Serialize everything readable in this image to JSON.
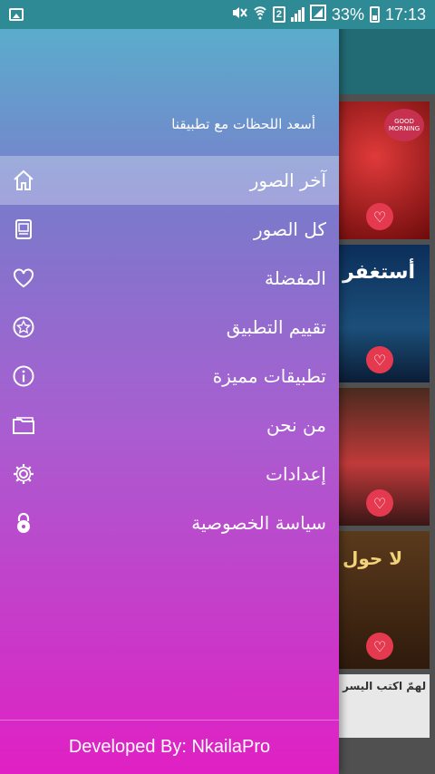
{
  "status_bar": {
    "battery_percent": "33%",
    "time": "17:13",
    "sim_slot": "2"
  },
  "drawer": {
    "header_text": "أسعد اللحظات مع تطبيقنا",
    "items": [
      {
        "label": "آخر الصور",
        "icon": "home-icon",
        "active": true
      },
      {
        "label": "كل الصور",
        "icon": "photo-album-icon",
        "active": false
      },
      {
        "label": "المفضلة",
        "icon": "heart-icon",
        "active": false
      },
      {
        "label": "تقييم التطبيق",
        "icon": "star-rate-icon",
        "active": false
      },
      {
        "label": "تطبيقات مميزة",
        "icon": "info-icon",
        "active": false
      },
      {
        "label": "من نحن",
        "icon": "folder-icon",
        "active": false
      },
      {
        "label": "إعدادات",
        "icon": "gear-icon",
        "active": false
      },
      {
        "label": "سياسة الخصوصية",
        "icon": "lock-icon",
        "active": false
      }
    ],
    "footer": "Developed By: NkailaPro"
  },
  "background_app": {
    "thumbnails": [
      {
        "text": "",
        "badge": "GOOD MORNING"
      },
      {
        "text": "أستغفر"
      },
      {
        "text": ""
      },
      {
        "text": "لا حول"
      },
      {
        "text": "لهمّ اكتب اليسر"
      }
    ]
  },
  "colors": {
    "status_bar": "#2e8a95",
    "drawer_gradient_top": "#55b5cc",
    "drawer_gradient_bottom": "#e020c4",
    "heart_button": "#e53950"
  }
}
